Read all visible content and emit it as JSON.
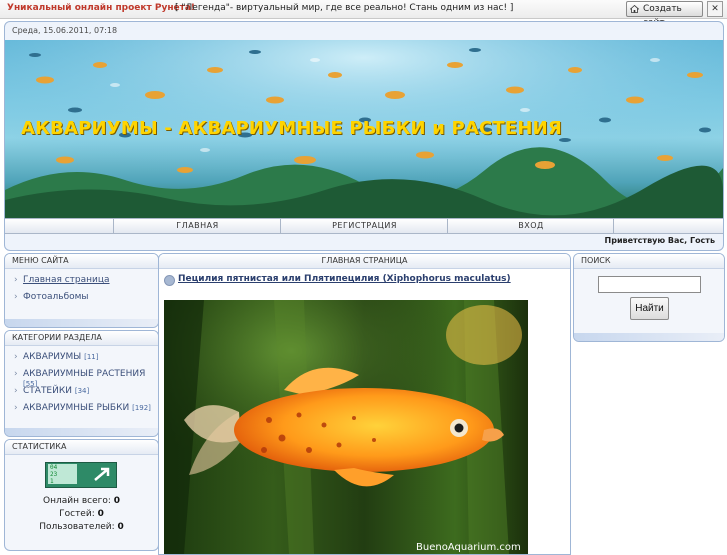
{
  "topbar": {
    "promo": "Уникальный онлайн проект Рунета!",
    "legend": "[ \"Легенда\"- виртуальный мир, где все реально! Стань одним из нас! ]",
    "create_site": "Создать сайт",
    "close": "✕"
  },
  "header": {
    "date": "Среда, 15.06.2011, 07:18",
    "site_title": "АКВАРИУМЫ - АКВАРИУМНЫЕ РЫБКИ и РАСТЕНИЯ",
    "nav": [
      "ГЛАВНАЯ",
      "РЕГИСТРАЦИЯ",
      "ВХОД"
    ],
    "greeting": "Приветствую Вас, Гость"
  },
  "site_menu": {
    "title": "МЕНЮ САЙТА",
    "items": [
      {
        "label": "Главная страница",
        "active": true
      },
      {
        "label": "Фотоальбомы",
        "active": false
      }
    ]
  },
  "categories": {
    "title": "КАТЕГОРИИ РАЗДЕЛА",
    "items": [
      {
        "label": "АКВАРИУМЫ",
        "count": "[11]"
      },
      {
        "label": "АКВАРИУМНЫЕ РАСТЕНИЯ",
        "count": "[55]"
      },
      {
        "label": "СТАТЕЙКИ",
        "count": "[34]"
      },
      {
        "label": "АКВАРИУМНЫЕ РЫБКИ",
        "count": "[192]"
      }
    ]
  },
  "stats": {
    "title": "СТАТИСТИКА",
    "counter_digits": [
      "04",
      "23",
      "1"
    ],
    "online_label": "Онлайн всего:",
    "online": "0",
    "guests_label": "Гостей:",
    "guests": "0",
    "users_label": "Пользователей:",
    "users": "0"
  },
  "main": {
    "title": "ГЛАВНАЯ СТРАНИЦА",
    "post_title": "Пецилия пятнистая или Плятипецилия (Xiphophorus maculatus)",
    "photo_watermark": "BuenoAquarium.com"
  },
  "search": {
    "title": "ПОИСК",
    "button": "Найти",
    "value": ""
  },
  "colors": {
    "title_yellow": "#ffd400",
    "panel_border": "#9fb6d6",
    "promo_red": "#c0392b",
    "link_blue": "#3b4f7a"
  }
}
